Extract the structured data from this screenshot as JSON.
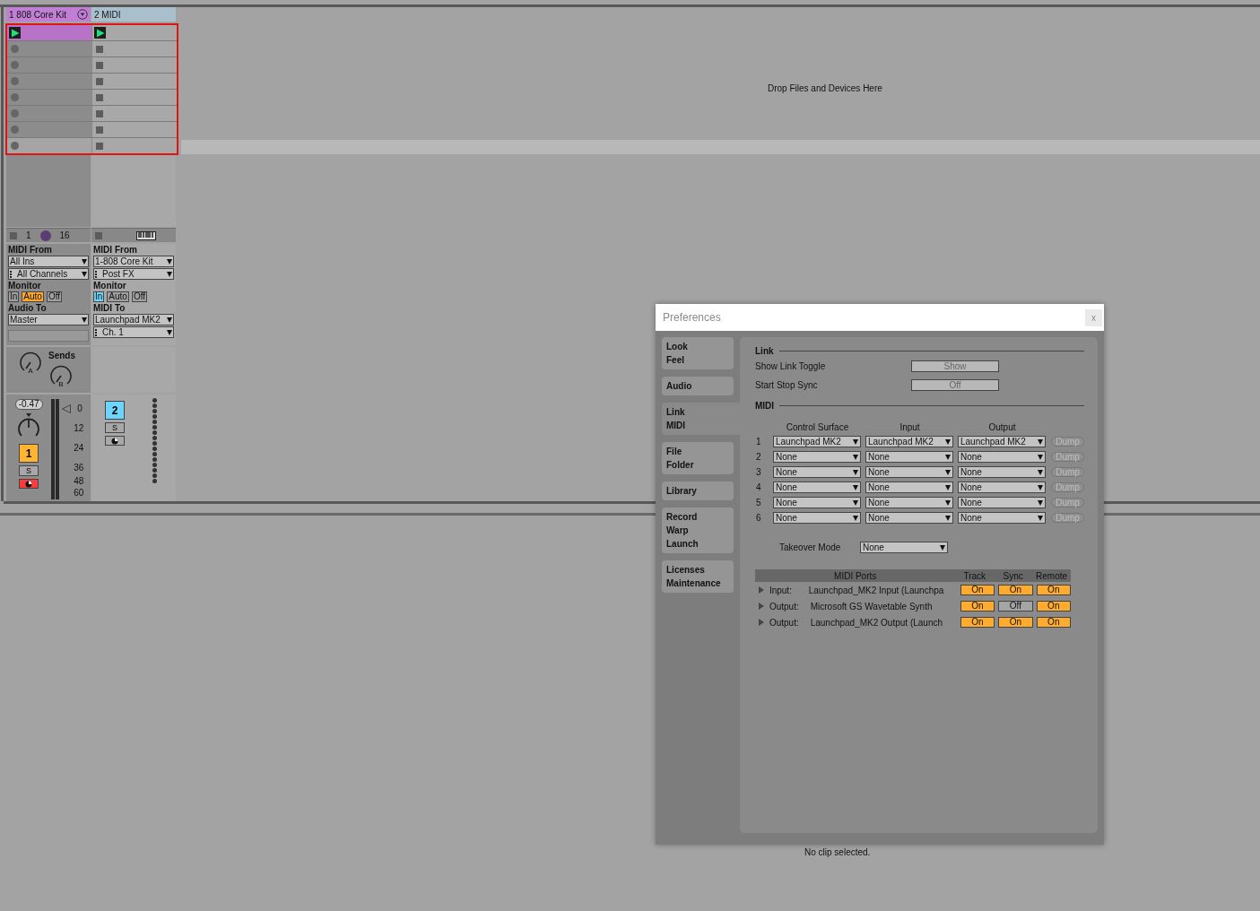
{
  "session": {
    "drop_hint": "Drop Files and Devices Here",
    "scenes": [
      {
        "selected": false
      },
      {
        "selected": false
      },
      {
        "selected": false
      },
      {
        "selected": false
      },
      {
        "selected": false
      },
      {
        "selected": false
      },
      {
        "selected": false
      },
      {
        "selected": true
      }
    ],
    "tracks": [
      {
        "kind": "drum",
        "name": "1 808 Core Kit",
        "color": "#c07fd4",
        "selected": true,
        "slots": [
          {
            "kind": "clip",
            "playing": true,
            "color": "#b873c8"
          },
          {
            "kind": "empty",
            "playing": false
          },
          {
            "kind": "empty",
            "playing": false
          },
          {
            "kind": "empty",
            "playing": false
          },
          {
            "kind": "empty",
            "playing": false
          },
          {
            "kind": "empty",
            "playing": false
          },
          {
            "kind": "empty",
            "playing": false
          },
          {
            "kind": "empty",
            "playing": false
          }
        ],
        "bar": {
          "low": "1",
          "high": "16"
        },
        "io": {
          "from_label": "MIDI From",
          "from": "All Ins",
          "channel": "All Channels",
          "monitor_label": "Monitor",
          "monitor": [
            {
              "label": "In",
              "selected": false
            },
            {
              "label": "Auto",
              "selected": true
            },
            {
              "label": "Off",
              "selected": false
            }
          ],
          "to_label": "Audio To",
          "to": "Master"
        },
        "sends": {
          "label": "Sends",
          "knobs": [
            "A",
            "B"
          ]
        },
        "mixer": {
          "volume": "-0.47",
          "scale": [
            "0",
            "12",
            "24",
            "36",
            "48",
            "60"
          ],
          "number": "1",
          "color": "#ffb532",
          "solo": "S",
          "armed": true
        }
      },
      {
        "kind": "midi",
        "name": "2 MIDI",
        "color": "#a9c0cc",
        "selected": false,
        "slots": [
          {
            "kind": "stop",
            "playing": true
          },
          {
            "kind": "stop",
            "playing": false
          },
          {
            "kind": "stop",
            "playing": false
          },
          {
            "kind": "stop",
            "playing": false
          },
          {
            "kind": "stop",
            "playing": false
          },
          {
            "kind": "stop",
            "playing": false
          },
          {
            "kind": "stop",
            "playing": false
          },
          {
            "kind": "stop",
            "playing": false
          }
        ],
        "io": {
          "from_label": "MIDI From",
          "from": "1-808 Core Kit",
          "channel": "Post FX",
          "monitor_label": "Monitor",
          "monitor": [
            {
              "label": "In",
              "selected": true
            },
            {
              "label": "Auto",
              "selected": false
            },
            {
              "label": "Off",
              "selected": false
            }
          ],
          "to_label": "MIDI To",
          "to": "Launchpad MK2",
          "to_channel": "Ch. 1"
        },
        "mixer": {
          "number": "2",
          "color": "#6dd5fb",
          "solo": "S",
          "armed": false
        }
      }
    ]
  },
  "detail": {
    "status": "No clip selected."
  },
  "preferences": {
    "title": "Preferences",
    "close": "x",
    "nav": [
      {
        "lines": [
          "Look",
          "Feel"
        ],
        "selected": false
      },
      {
        "lines": [
          "Audio"
        ],
        "selected": false
      },
      {
        "lines": [
          "Link",
          "MIDI"
        ],
        "selected": true
      },
      {
        "lines": [
          "File",
          "Folder"
        ],
        "selected": false
      },
      {
        "lines": [
          "Library"
        ],
        "selected": false
      },
      {
        "lines": [
          "Record",
          "Warp",
          "Launch"
        ],
        "selected": false
      },
      {
        "lines": [
          "Licenses",
          "Maintenance"
        ],
        "selected": false
      }
    ],
    "link": {
      "heading": "Link",
      "rows": [
        {
          "label": "Show Link Toggle",
          "value": "Show"
        },
        {
          "label": "Start Stop Sync",
          "value": "Off"
        }
      ]
    },
    "midi": {
      "heading": "MIDI",
      "columns": [
        "Control Surface",
        "Input",
        "Output"
      ],
      "rows": [
        {
          "number": "1",
          "surface": "Launchpad MK2",
          "input": "Launchpad MK2",
          "output": "Launchpad MK2",
          "dump": "Dump",
          "dump_disabled": true
        },
        {
          "number": "2",
          "surface": "None",
          "input": "None",
          "output": "None",
          "dump": "Dump",
          "dump_disabled": true
        },
        {
          "number": "3",
          "surface": "None",
          "input": "None",
          "output": "None",
          "dump": "Dump",
          "dump_disabled": true
        },
        {
          "number": "4",
          "surface": "None",
          "input": "None",
          "output": "None",
          "dump": "Dump",
          "dump_disabled": true
        },
        {
          "number": "5",
          "surface": "None",
          "input": "None",
          "output": "None",
          "dump": "Dump",
          "dump_disabled": true
        },
        {
          "number": "6",
          "surface": "None",
          "input": "None",
          "output": "None",
          "dump": "Dump",
          "dump_disabled": true
        }
      ],
      "takeover_label": "Takeover Mode",
      "takeover": "None"
    },
    "ports": {
      "columns": [
        "MIDI Ports",
        "Track",
        "Sync",
        "Remote"
      ],
      "rows": [
        {
          "direction": "Input:",
          "name": "Launchpad_MK2 Input (Launchpa",
          "track": {
            "label": "On",
            "on": true
          },
          "sync": {
            "label": "On",
            "on": true
          },
          "remote": {
            "label": "On",
            "on": true
          }
        },
        {
          "direction": "Output:",
          "name": "Microsoft GS Wavetable Synth",
          "track": {
            "label": "On",
            "on": true
          },
          "sync": {
            "label": "Off",
            "on": false
          },
          "remote": {
            "label": "On",
            "on": true
          }
        },
        {
          "direction": "Output:",
          "name": "Launchpad_MK2 Output (Launch",
          "track": {
            "label": "On",
            "on": true
          },
          "sync": {
            "label": "On",
            "on": true
          },
          "remote": {
            "label": "On",
            "on": true
          }
        }
      ]
    }
  }
}
